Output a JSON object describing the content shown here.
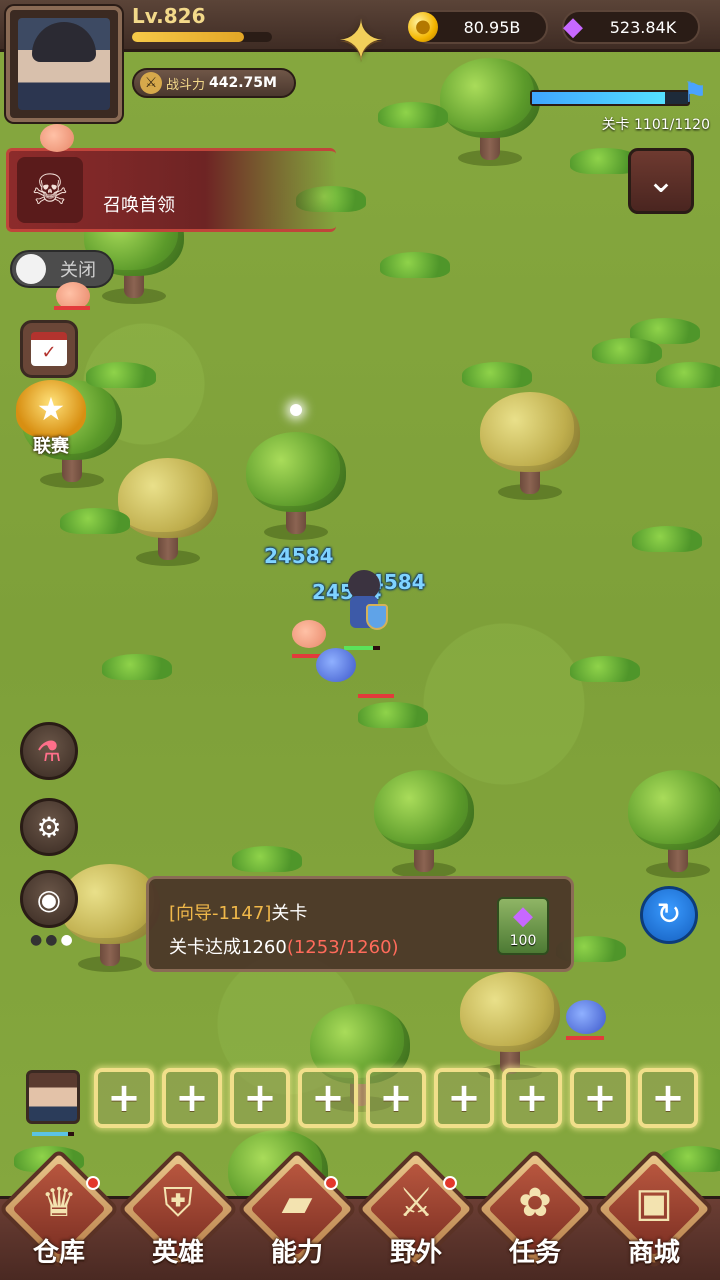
{
  "player": {
    "level": "Lv.826",
    "xp_fraction": 0.8,
    "power_label": "战斗力",
    "power_value": "442.75M"
  },
  "currency": {
    "gold": "80.95B",
    "gems": "523.84K"
  },
  "stage": {
    "progress_label": "关卡 1101/1120",
    "progress_fraction": 0.85
  },
  "summon_boss": {
    "label": "召唤首领"
  },
  "auto_toggle": {
    "label": "关闭",
    "state": "off"
  },
  "league": {
    "label": "联赛"
  },
  "damage_numbers": [
    "24584",
    "24584",
    "24584"
  ],
  "quest": {
    "tag": "[向导-1147]",
    "title": "关卡",
    "goal_prefix": "关卡达成1260",
    "goal_progress": "(1253/1260)",
    "reward_amount": "100"
  },
  "team": {
    "empty_slot_symbol": "+",
    "empty_slots": 9
  },
  "nav": [
    {
      "label": "仓库",
      "icon": "warehouse-icon",
      "badge": true
    },
    {
      "label": "英雄",
      "icon": "hero-helmet-icon",
      "badge": false
    },
    {
      "label": "能力",
      "icon": "ability-gold-icon",
      "badge": true
    },
    {
      "label": "野外",
      "icon": "crossed-swords-icon",
      "badge": true
    },
    {
      "label": "任务",
      "icon": "quest-scroll-icon",
      "badge": false
    },
    {
      "label": "商城",
      "icon": "shop-chest-icon",
      "badge": false
    }
  ]
}
